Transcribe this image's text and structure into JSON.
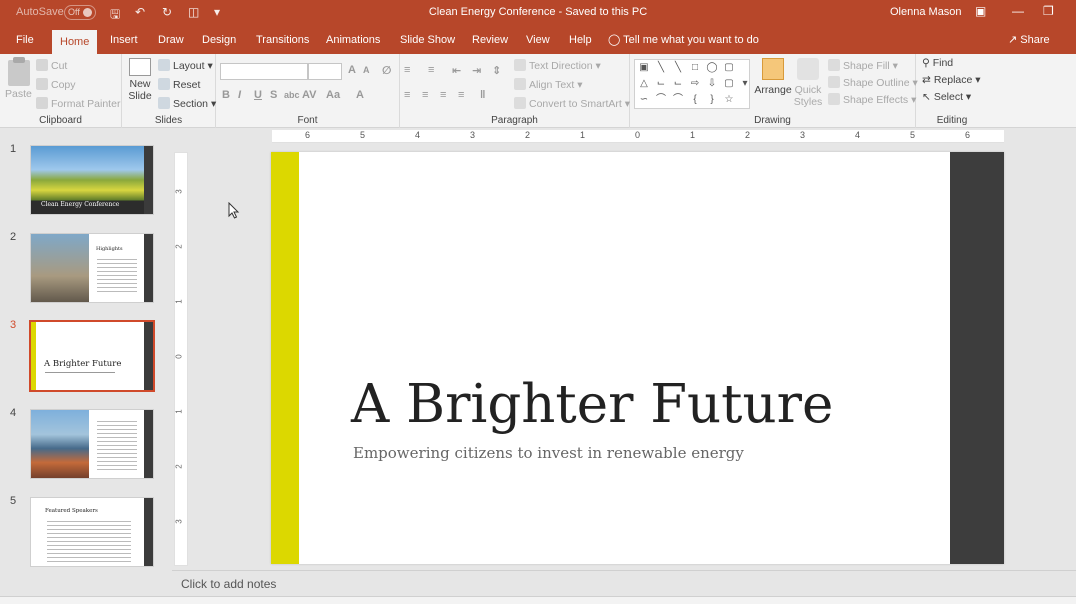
{
  "window": {
    "autosave_label": "AutoSave",
    "autosave_state": "Off",
    "title": "Clean Energy Conference  -  Saved to this PC",
    "user": "Olenna Mason"
  },
  "tabs": [
    "File",
    "Home",
    "Insert",
    "Draw",
    "Design",
    "Transitions",
    "Animations",
    "Slide Show",
    "Review",
    "View",
    "Help"
  ],
  "tell_me": "Tell me what you want to do",
  "share": "Share",
  "ribbon": {
    "clipboard": {
      "label": "Clipboard",
      "paste": "Paste",
      "cut": "Cut",
      "copy": "Copy",
      "format_painter": "Format Painter"
    },
    "slides": {
      "label": "Slides",
      "new_slide": "New Slide",
      "layout": "Layout",
      "reset": "Reset",
      "section": "Section"
    },
    "font": {
      "label": "Font"
    },
    "paragraph": {
      "label": "Paragraph",
      "text_direction": "Text Direction",
      "align_text": "Align Text",
      "convert_smartart": "Convert to SmartArt"
    },
    "drawing": {
      "label": "Drawing",
      "arrange": "Arrange",
      "quick_styles": "Quick Styles",
      "shape_fill": "Shape Fill",
      "shape_outline": "Shape Outline",
      "shape_effects": "Shape Effects"
    },
    "editing": {
      "label": "Editing",
      "find": "Find",
      "replace": "Replace",
      "select": "Select"
    }
  },
  "thumbnails": [
    {
      "num": "1",
      "title": "Clean Energy Conference"
    },
    {
      "num": "2",
      "title": "Highlights"
    },
    {
      "num": "3",
      "title": "A Brighter Future"
    },
    {
      "num": "4",
      "title": ""
    },
    {
      "num": "5",
      "title": "Featured Speakers"
    }
  ],
  "slide": {
    "title": "A Brighter Future",
    "subtitle": "Empowering citizens to invest in renewable energy",
    "accent_color": "#dcd800",
    "side_color": "#3d3d3d"
  },
  "hruler_ticks": [
    "6",
    "5",
    "4",
    "3",
    "2",
    "1",
    "0",
    "1",
    "2",
    "3",
    "4",
    "5",
    "6"
  ],
  "vruler_ticks": [
    "3",
    "2",
    "1",
    "0",
    "1",
    "2",
    "3"
  ],
  "notes_placeholder": "Click to add notes",
  "colors": {
    "brand": "#b7472a",
    "ribbon_bg": "#f3f3f3"
  }
}
